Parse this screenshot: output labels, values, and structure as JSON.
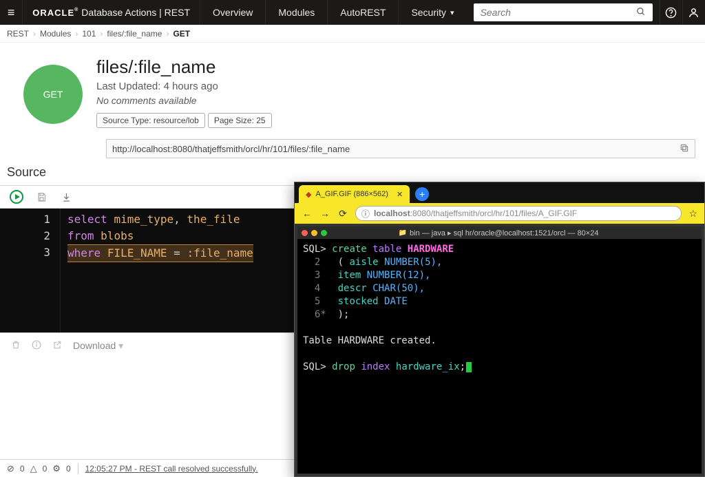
{
  "nav": {
    "oracle": "ORACLE",
    "product": "Database Actions | REST",
    "items": [
      "Overview",
      "Modules",
      "AutoREST",
      "Security"
    ],
    "search_placeholder": "Search"
  },
  "breadcrumbs": [
    "REST",
    "Modules",
    "101",
    "files/:file_name",
    "GET"
  ],
  "endpoint": {
    "method": "GET",
    "title": "files/:file_name",
    "last_updated": "Last Updated: 4 hours ago",
    "no_comments": "No comments available",
    "pill_source_type": "Source Type: resource/lob",
    "pill_page_size": "Page Size: 25",
    "url": "http://localhost:8080/thatjeffsmith/orcl/hr/101/files/:file_name"
  },
  "source": {
    "heading": "Source",
    "lines": {
      "l1": {
        "kw": "select",
        "c1": "mime_type",
        "comma": ",",
        "c2": "the_file"
      },
      "l2": {
        "kw": "from",
        "t": "blobs"
      },
      "l3": {
        "kw": "where",
        "col": "FILE_NAME",
        "op": "=",
        "bind": ":file_name"
      }
    },
    "line_nums": [
      "1",
      "2",
      "3"
    ]
  },
  "results_bar": {
    "download": "Download"
  },
  "status": {
    "err_count": "0",
    "warn_count": "0",
    "gear_count": "0",
    "time": "12:05:27 PM",
    "msg": "REST call resolved successfully."
  },
  "browser": {
    "tab_title": "A_GIF.GIF (886×562)",
    "addr_host": "localhost",
    "addr_port": ":8080",
    "addr_path": "/thatjeffsmith/orcl/hr/101/files/A_GIF.GIF",
    "term_title": "bin — java ▸ sql hr/oracle@localhost:1521/orcl — 80×24",
    "sql": {
      "p1_prompt": "SQL>",
      "p1_kw1": "create",
      "p1_kw2": "table",
      "p1_tbl": "HARDWARE",
      "r2_num": "2",
      "r2_open": "(",
      "r2_col": "aisle",
      "r2_type": "NUMBER(5),",
      "r3_num": "3",
      "r3_col": "item",
      "r3_type": "NUMBER(12),",
      "r4_num": "4",
      "r4_col": "descr",
      "r4_type": "CHAR(50),",
      "r5_num": "5",
      "r5_col": "stocked",
      "r5_type": "DATE",
      "r6_num": "6*",
      "r6_close": ");",
      "created_msg": "Table HARDWARE created.",
      "p2_prompt": "SQL>",
      "p2_kw1": "drop",
      "p2_kw2": "index",
      "p2_ident": "hardware_ix",
      "p2_semi": ";"
    }
  }
}
